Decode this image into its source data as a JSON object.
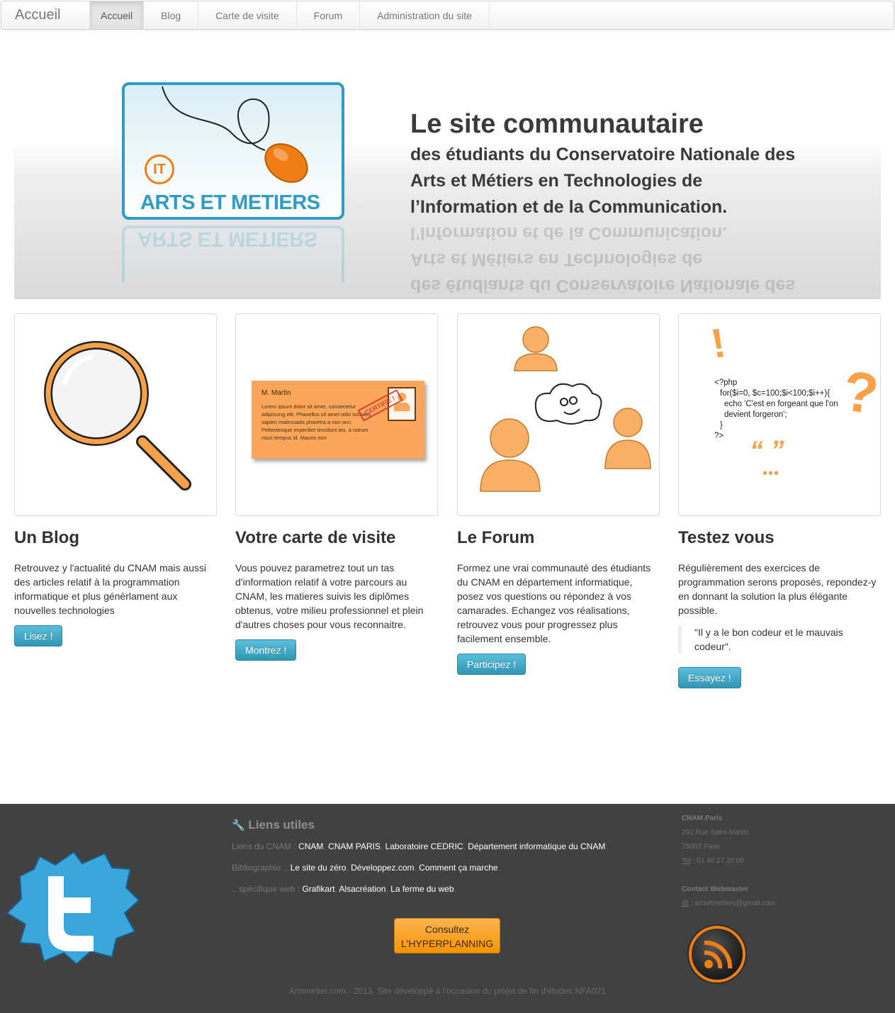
{
  "nav": {
    "brand": "Accueil",
    "items": [
      "Accueil",
      "Blog",
      "Carte de visite",
      "Forum",
      "Administration du site"
    ]
  },
  "hero": {
    "logo_it": "IT",
    "logo_text": "ARTS ET METIERS",
    "title": "Le site communautaire",
    "subtitle": "des étudiants du Conservatoire Nationale des Arts et Métiers en Technologies de l’Information et de la Communication."
  },
  "features": [
    {
      "title": "Un Blog",
      "text": "Retrouvez y l'actualité du CNAM mais aussi des articles relatif à la programmation informatique et plus génèrlament aux nouvelles technologies",
      "button": "Lisez !"
    },
    {
      "title": "Votre carte de visite",
      "text": "Vous pouvez parametrez tout un tas d'information relatif à votre parcours au CNAM, les matieres suivis les diplômes obtenus, votre milieu professionnel et plein d'autres choses pour vous reconnaitre.",
      "button": "Montrez !",
      "card_name": "M. Martin",
      "card_text": "Lorem ipsum dolor sit amet, consectetur adipiscing elit. Phasellus sit amet odio sodales sapien malesuada pharetra a non orci. Pellentesque imperdiet tincidunt leo, a rutrum risus tempus id. Mauris non",
      "stamp": "CERTIFIÉ !"
    },
    {
      "title": "Le Forum",
      "text": "Formez une vrai communauté des étudiants du CNAM en département informatique, posez vos questions ou répondez à vos camarades. Echangez vos réalisations, retrouvez vous pour progressez plus facilement ensemble.",
      "button": "Participez !"
    },
    {
      "title": "Testez vous",
      "text": "Régulièrement des exercices de programmation serons proposés, repondez-y en donnant la solution la plus élégante possible.",
      "quote": "\"Il y a le bon codeur et le mauvais codeur\".",
      "button": "Essayez !",
      "code": [
        "<?php",
        "for($i=0, $c=100;$i<100;$i++){",
        "echo 'C'est en forgeant que l'on devient forgeron';",
        "}",
        "?>"
      ],
      "symbols": [
        "!",
        "?",
        "“ ”",
        "•••"
      ]
    }
  ],
  "footer": {
    "liens_title": "Liens utiles",
    "rows": [
      {
        "label": "Liens du CNAM : ",
        "links": [
          "CNAM",
          "CNAM PARIS",
          "Laboratoire CEDRIC",
          "Département informatique du CNAM"
        ],
        "end": "."
      },
      {
        "label": "Bibliographie .. ",
        "links": [
          "Le site du zéro",
          "Développez.com",
          "Comment ça marche"
        ],
        "end": "."
      },
      {
        "label": ".. spécifique web : ",
        "links": [
          "Grafikart",
          "Alsacréation",
          "La ferme du web"
        ],
        "end": "."
      }
    ],
    "hyper_line1": "Consultez",
    "hyper_line2": "L'HYPERPLANNING",
    "copyright": "Artsmetier.com - 2013. Site développé à l'occasion du projet de fin d'études NFA021",
    "contact": {
      "org": "CNAM Paris",
      "street": "292 Rue Saint-Martin",
      "city": "75003 Paris",
      "tel_label": "Tel",
      "tel": " : 01 40 27 20 00",
      "webmaster_label": "Contact Webmaster",
      "email_label": "@",
      "email": " : artsetmetiers@gmail.com"
    }
  },
  "colors": {
    "accent_blue": "#2f9bc6",
    "accent_orange": "#f07e17",
    "button_info": "#49afcd",
    "footer_bg": "#414141"
  }
}
